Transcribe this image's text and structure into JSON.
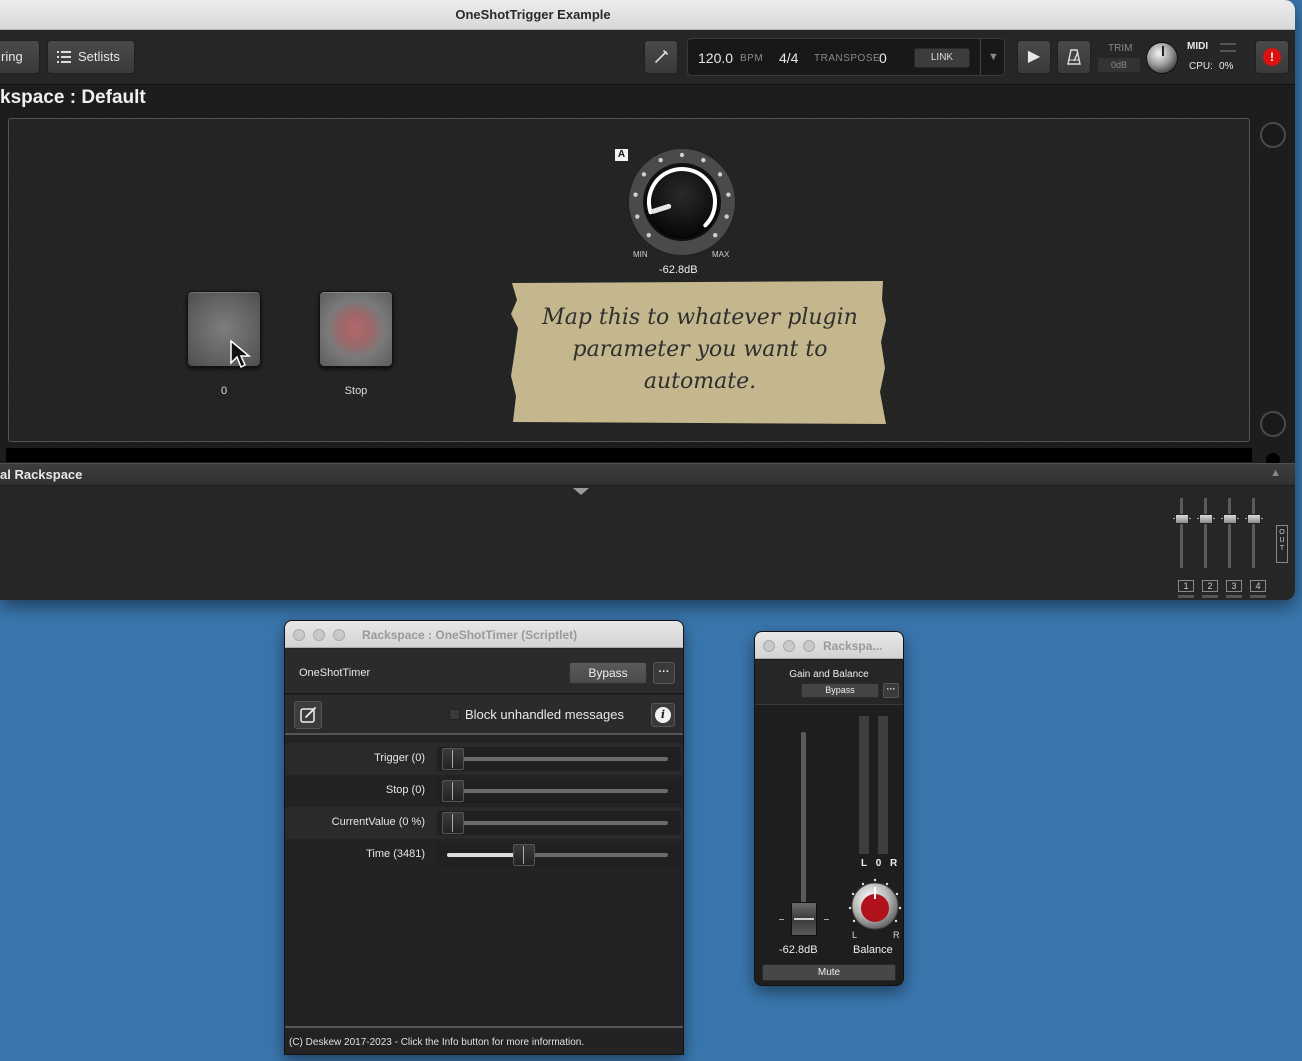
{
  "main_window": {
    "title": "OneShotTrigger Example",
    "toolbar": {
      "wiring_label": "ring",
      "setlists_label": "Setlists",
      "tuner_icon": "tuning-fork-icon",
      "tempo": "120.0",
      "tempo_unit": "BPM",
      "time_signature": "4/4",
      "transpose_label": "TRANSPOSE",
      "transpose_value": "0",
      "link_label": "LINK",
      "trim_label": "TRIM",
      "trim_value": "0dB",
      "midi_label": "MIDI",
      "cpu_label": "CPU:",
      "cpu_value": "0%",
      "panic_icon": "!"
    },
    "rackspace_title": "kspace : Default",
    "panel": {
      "knob_badge": "A",
      "knob_min": "MIN",
      "knob_max": "MAX",
      "knob_value": "-62.8dB",
      "knob_level": 0.1,
      "trigger_pad_label": "0",
      "stop_pad_label": "Stop",
      "note_text": "Map this to whatever plugin parameter you want to automate.",
      "note_color": "#c4b78e"
    },
    "global": {
      "title": "al Rackspace",
      "channels": [
        "1",
        "2",
        "3",
        "4"
      ],
      "out_label": "OUT"
    }
  },
  "scriptlet_window": {
    "title": "Rackspace : OneShotTimer (Scriptlet)",
    "plugin_name": "OneShotTimer",
    "bypass_label": "Bypass",
    "more_label": "···",
    "block_label": "Block unhandled messages",
    "block_checked": false,
    "info_label": "i",
    "params": [
      {
        "label": "Trigger (0)",
        "value": 0
      },
      {
        "label": "Stop (0)",
        "value": 0
      },
      {
        "label": "CurrentValue (0 %)",
        "value": 0
      },
      {
        "label": "Time (3481)",
        "value": 0.35
      }
    ],
    "footer": "(C) Deskew 2017-2023 - Click the Info button for more information."
  },
  "gb_window": {
    "title": "Rackspa...",
    "plugin_name": "Gain and Balance",
    "bypass_label": "Bypass",
    "more_label": "···",
    "gain_value": "-62.8dB",
    "lor_label": "L 0 R",
    "bal_left": "L",
    "bal_right": "R",
    "balance_label": "Balance",
    "mute_label": "Mute",
    "accent_color": "#b0111a"
  }
}
